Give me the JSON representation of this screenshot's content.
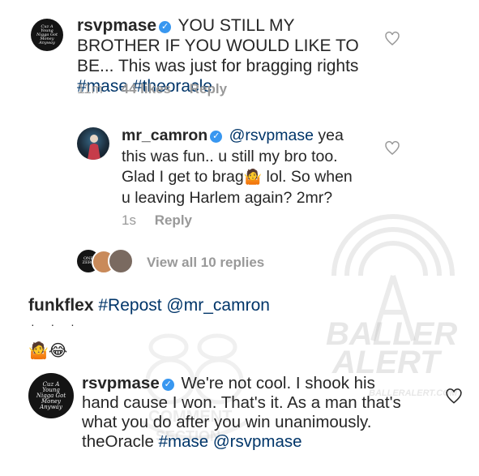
{
  "comments": [
    {
      "username": "rsvpmase",
      "text": "YOU STILL MY BROTHER IF YOU WOULD LIKE TO BE... This was just for bragging rights",
      "tags": [
        "#mase",
        "#theoracle"
      ],
      "time": "11m",
      "likes": "44 likes",
      "reply_label": "Reply"
    },
    {
      "username": "mr_camron",
      "mention": "@rsvpmase",
      "text_a": "yea this was fun.. u still my bro too. Glad I get to brag",
      "emoji": "🤷",
      "text_b": "lol. So when u leaving Harlem again? 2mr?",
      "time": "1s",
      "reply_label": "Reply"
    }
  ],
  "view_replies": "View all 10 replies",
  "caption": {
    "username": "funkflex",
    "tag": "#Repost",
    "mention": "@mr_camron",
    "dots": "· · ·",
    "emojis": "🤷😂"
  },
  "post_comment": {
    "username": "rsvpmase",
    "text": "We're not cool. I shook his hand cause I won. That's it. As a man that's what you do after you win unanimously. theOracle",
    "tag": "#mase",
    "mention": "@rsvpmase"
  },
  "avatars": {
    "mase_logo_text": "Cuz A Young Nigga Got Money Anyway",
    "small_logo_text": "ONE ZERO"
  },
  "watermark": {
    "brand_line1": "BALLER",
    "brand_line2": "ALERT",
    "url": "BALLERALERT.COM",
    "comment_text": "COMMENT",
    "section_text": "SECTION"
  },
  "colors": {
    "text": "#262626",
    "muted": "#999999",
    "link": "#003569",
    "verified": "#3897f0"
  }
}
